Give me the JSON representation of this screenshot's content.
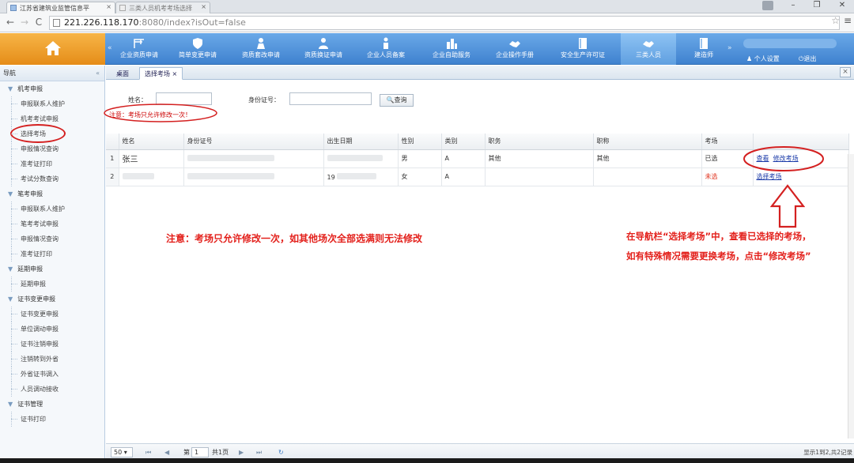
{
  "browser": {
    "tabs": [
      {
        "label": "江苏省建筑业监管信息平",
        "active": true
      },
      {
        "label": "三类人员机考考场选择",
        "active": false
      }
    ],
    "address_host": "221.226.118.170",
    "address_rest": ":8080/index?isOut=false"
  },
  "header": {
    "nav": [
      {
        "label": "企业资质申请",
        "icon": "crane-icon"
      },
      {
        "label": "简单变更申请",
        "icon": "shield-icon"
      },
      {
        "label": "资质套改申请",
        "icon": "worker-icon"
      },
      {
        "label": "资质换证申请",
        "icon": "people-icon"
      },
      {
        "label": "企业人员备案",
        "icon": "person-badge-icon"
      },
      {
        "label": "企业自助服务",
        "icon": "buildings-icon"
      },
      {
        "label": "企业操作手册",
        "icon": "handshake-icon"
      },
      {
        "label": "安全生产许可证",
        "icon": "book-icon"
      },
      {
        "label": "三类人员",
        "icon": "handshake-icon"
      },
      {
        "label": "建造师",
        "icon": "book-icon"
      }
    ],
    "selected_nav": "三类人员",
    "user_settings": "个人设置",
    "logout": "退出"
  },
  "sidebar": {
    "title": "导航",
    "groups": [
      {
        "label": "机考申报",
        "items": [
          "申报联系人维护",
          "机考考试申报",
          "选择考场",
          "申报情况查询",
          "准考证打印",
          "考试分数查询"
        ]
      },
      {
        "label": "笔考申报",
        "items": [
          "申报联系人维护",
          "笔考考试申报",
          "申报情况查询",
          "准考证打印"
        ]
      },
      {
        "label": "延期申报",
        "items": [
          "延期申报"
        ]
      },
      {
        "label": "证书变更申报",
        "items": [
          "证书变更申报",
          "单位调动申报",
          "证书注销申报",
          "注销转到外省",
          "外省证书调入",
          "人员调动接收"
        ]
      },
      {
        "label": "证书管理",
        "items": [
          "证书打印"
        ]
      }
    ]
  },
  "content_tabs": [
    "桌面",
    "选择考场"
  ],
  "search": {
    "name_label": "姓名：",
    "id_label": "身份证号：",
    "query_button": "查询",
    "notice": "注意：考场只允许修改一次！"
  },
  "table": {
    "columns": [
      "",
      "姓名",
      "身份证号",
      "出生日期",
      "性别",
      "类别",
      "职务",
      "职称",
      "考场",
      ""
    ],
    "rows": [
      {
        "n": "1",
        "name": "张三",
        "gender": "男",
        "category": "A",
        "duty": "其他",
        "title": "其他",
        "status": "已选",
        "actions": [
          "查看",
          "修改考场"
        ]
      },
      {
        "n": "2",
        "name": "",
        "birth_prefix": "19",
        "gender": "女",
        "category": "A",
        "duty": "",
        "title": "",
        "status": "未选",
        "actions": [
          "选择考场"
        ]
      }
    ]
  },
  "annotations": {
    "left": "注意：考场只允许修改一次，如其他场次全部选满则无法修改",
    "right_line1": "在导航栏“选择考场”中，查看已选择的考场，",
    "right_line2": "如有特殊情况需要更换考场，点击“修改考场”"
  },
  "pager": {
    "page_size": "50",
    "page_label_pre": "第",
    "page_value": "1",
    "page_label_post": "共1页",
    "info": "显示1到2,共2记录"
  },
  "colors": {
    "header_blue": "#3f82cf",
    "home_orange": "#e58c18",
    "annotation_red": "#e3201b",
    "link_blue": "#1a3aa8"
  }
}
